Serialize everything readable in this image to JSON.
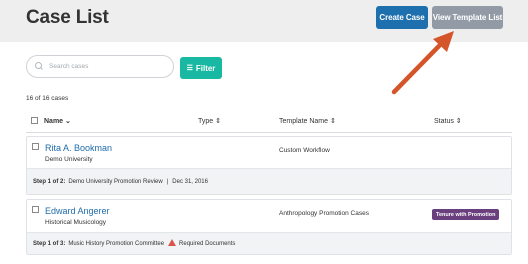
{
  "header": {
    "title": "Case List",
    "create_label": "Create Case",
    "template_label": "View Template List"
  },
  "toolbar": {
    "search_placeholder": "Search cases",
    "filter_label": "Filter",
    "count_text": "16 of 16 cases"
  },
  "table": {
    "columns": {
      "name": "Name ⌄",
      "type": "Type ⇕",
      "template": "Template Name ⇕",
      "status": "Status ⇕"
    },
    "rows": [
      {
        "name": "Rita A. Bookman",
        "subtitle": "Demo University",
        "template": "Custom Workflow",
        "step_label": "Step 1 of 2:",
        "step_text": "Demo University Promotion Review",
        "separator": "|",
        "date": "Dec 31, 2016"
      },
      {
        "name": "Edward Angerer",
        "subtitle": "Historical Musicology",
        "template": "Anthropology Promotion Cases",
        "status": "Tenure with Promotion",
        "step_label": "Step 1 of 3:",
        "step_text": "Music History Promotion Committee",
        "warning": "Required Documents"
      }
    ]
  },
  "colors": {
    "create_button": "#1e6fae",
    "template_button": "#929aa6",
    "filter_button": "#18b8a2",
    "status_badge": "#6a3f7e",
    "link": "#1f6cab",
    "annotation_arrow": "#d4552a",
    "warning": "#d9534f"
  },
  "icons": {
    "search": "search-icon",
    "filter": "sliders-icon",
    "warning": "warning-icon",
    "annotation": "arrow-icon"
  }
}
